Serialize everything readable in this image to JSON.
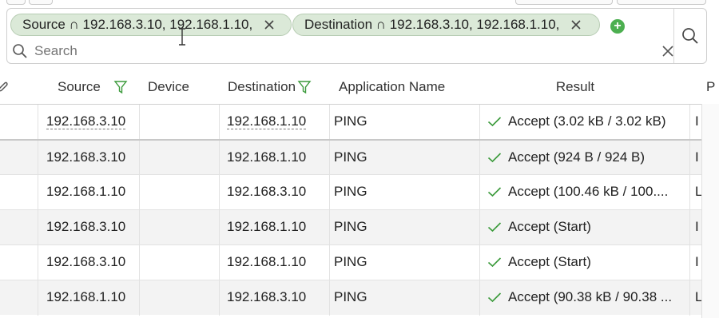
{
  "filters": {
    "chips": [
      {
        "label": "Source ∩ 192.168.3.10, 192.168.1.10,"
      },
      {
        "label": "Destination ∩ 192.168.3.10, 192.168.1.10,"
      }
    ],
    "search_placeholder": "Search"
  },
  "table": {
    "columns": [
      "Source",
      "Device",
      "Destination",
      "Application Name",
      "Result",
      "P"
    ],
    "rows": [
      {
        "source": "192.168.3.10",
        "device": "",
        "destination": "192.168.1.10",
        "app": "PING",
        "result": "Accept (3.02 kB / 3.02 kB)",
        "p": "I"
      },
      {
        "source": "192.168.3.10",
        "device": "",
        "destination": "192.168.1.10",
        "app": "PING",
        "result": "Accept (924 B / 924 B)",
        "p": "I"
      },
      {
        "source": "192.168.1.10",
        "device": "",
        "destination": "192.168.3.10",
        "app": "PING",
        "result": "Accept (100.46 kB / 100....",
        "p": "L"
      },
      {
        "source": "192.168.3.10",
        "device": "",
        "destination": "192.168.1.10",
        "app": "PING",
        "result": "Accept (Start)",
        "p": "I"
      },
      {
        "source": "192.168.3.10",
        "device": "",
        "destination": "192.168.1.10",
        "app": "PING",
        "result": "Accept (Start)",
        "p": "I"
      },
      {
        "source": "192.168.1.10",
        "device": "",
        "destination": "192.168.3.10",
        "app": "PING",
        "result": "Accept (90.38 kB / 90.38 ...",
        "p": "L"
      }
    ]
  },
  "colors": {
    "chip_bg": "#dbe9d8",
    "accept_check": "#3a9a3a",
    "filter_icon": "#3a9a3a",
    "add_button": "#4caf50"
  }
}
